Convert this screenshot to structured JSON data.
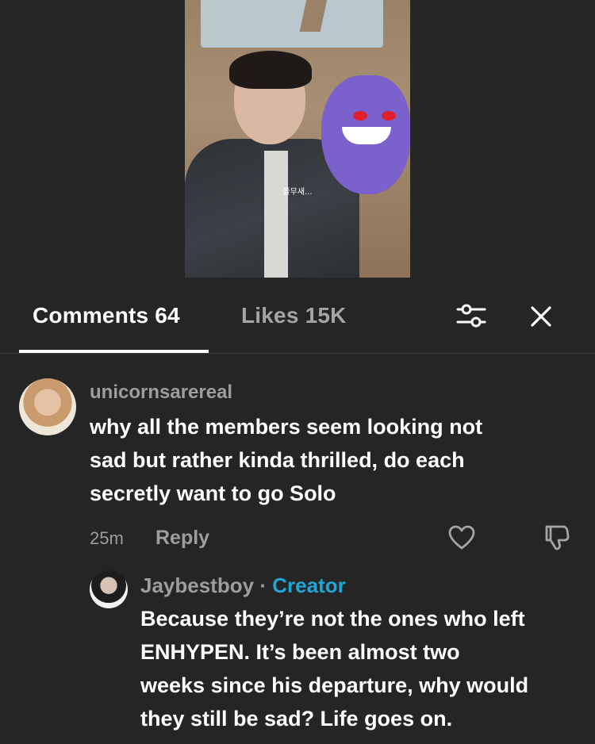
{
  "video": {
    "subtitle": "쫄무새..."
  },
  "tabs": {
    "comments_label": "Comments 64",
    "likes_label": "Likes 15K"
  },
  "icons": {
    "filter": "sliders-icon",
    "close": "close-icon",
    "like": "heart-icon",
    "dislike": "thumbs-down-icon"
  },
  "comments": [
    {
      "username": "unicornsarereal",
      "text": "why all the members seem looking not\nsad but rather kinda thrilled, do each\nsecretly want to go Solo",
      "time": "25m",
      "reply_label": "Reply"
    }
  ],
  "reply": {
    "username": "Jaybestboy",
    "separator": "·",
    "badge": "Creator",
    "text": "Because they’re not the ones who left\nENHYPEN. It’s been almost two\nweeks since his departure, why would\nthey still be sad? Life goes on."
  },
  "colors": {
    "background": "#252526",
    "creator_badge": "#1fa6d6",
    "muted_text": "#9d9d9f"
  }
}
